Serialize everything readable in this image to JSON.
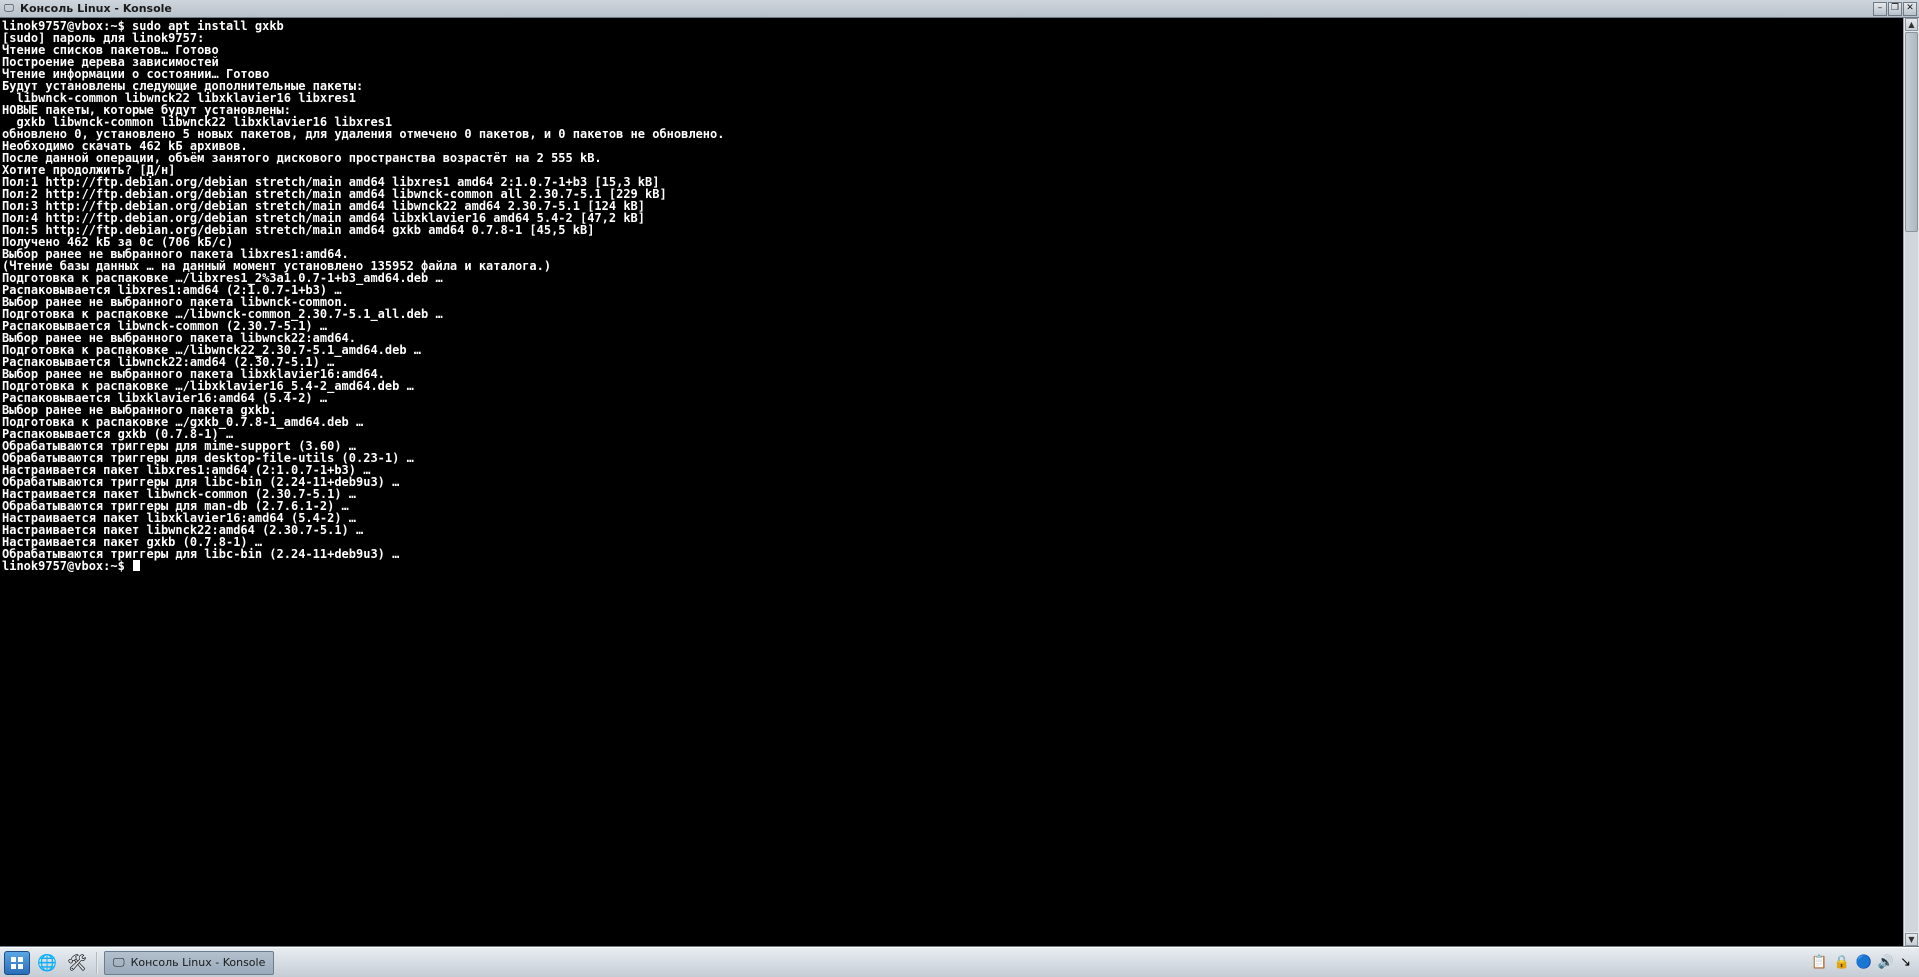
{
  "window": {
    "title": "Консоль Linux - Konsole"
  },
  "terminal": {
    "prompt1": "linok9757@vbox:~$ ",
    "command1": "sudo apt install gxkb",
    "lines": [
      "[sudo] пароль для linok9757:",
      "Чтение списков пакетов… Готово",
      "Построение дерева зависимостей",
      "Чтение информации о состоянии… Готово",
      "Будут установлены следующие дополнительные пакеты:",
      "  libwnck-common libwnck22 libxklavier16 libxres1",
      "НОВЫЕ пакеты, которые будут установлены:",
      "  gxkb libwnck-common libwnck22 libxklavier16 libxres1",
      "обновлено 0, установлено 5 новых пакетов, для удаления отмечено 0 пакетов, и 0 пакетов не обновлено.",
      "Необходимо скачать 462 kБ архивов.",
      "После данной операции, объём занятого дискового пространства возрастёт на 2 555 kB.",
      "Хотите продолжить? [Д/н]",
      "Пол:1 http://ftp.debian.org/debian stretch/main amd64 libxres1 amd64 2:1.0.7-1+b3 [15,3 kB]",
      "Пол:2 http://ftp.debian.org/debian stretch/main amd64 libwnck-common all 2.30.7-5.1 [229 kB]",
      "Пол:3 http://ftp.debian.org/debian stretch/main amd64 libwnck22 amd64 2.30.7-5.1 [124 kB]",
      "Пол:4 http://ftp.debian.org/debian stretch/main amd64 libxklavier16 amd64 5.4-2 [47,2 kB]",
      "Пол:5 http://ftp.debian.org/debian stretch/main amd64 gxkb amd64 0.7.8-1 [45,5 kB]",
      "Получено 462 kБ за 0с (706 kБ/c)",
      "Выбор ранее не выбранного пакета libxres1:amd64.",
      "(Чтение базы данных … на данный момент установлено 135952 файла и каталога.)",
      "Подготовка к распаковке …/libxres1_2%3a1.0.7-1+b3_amd64.deb …",
      "Распаковывается libxres1:amd64 (2:1.0.7-1+b3) …",
      "Выбор ранее не выбранного пакета libwnck-common.",
      "Подготовка к распаковке …/libwnck-common_2.30.7-5.1_all.deb …",
      "Распаковывается libwnck-common (2.30.7-5.1) …",
      "Выбор ранее не выбранного пакета libwnck22:amd64.",
      "Подготовка к распаковке …/libwnck22_2.30.7-5.1_amd64.deb …",
      "Распаковывается libwnck22:amd64 (2.30.7-5.1) …",
      "Выбор ранее не выбранного пакета libxklavier16:amd64.",
      "Подготовка к распаковке …/libxklavier16_5.4-2_amd64.deb …",
      "Распаковывается libxklavier16:amd64 (5.4-2) …",
      "Выбор ранее не выбранного пакета gxkb.",
      "Подготовка к распаковке …/gxkb_0.7.8-1_amd64.deb …",
      "Распаковывается gxkb (0.7.8-1) …",
      "Обрабатываются триггеры для mime-support (3.60) …",
      "Обрабатываются триггеры для desktop-file-utils (0.23-1) …",
      "Настраивается пакет libxres1:amd64 (2:1.0.7-1+b3) …",
      "Обрабатываются триггеры для libc-bin (2.24-11+deb9u3) …",
      "Настраивается пакет libwnck-common (2.30.7-5.1) …",
      "Обрабатываются триггеры для man-db (2.7.6.1-2) …",
      "Настраивается пакет libxklavier16:amd64 (5.4-2) …",
      "Настраивается пакет libwnck22:amd64 (2.30.7-5.1) …",
      "Настраивается пакет gxkb (0.7.8-1) …",
      "Обрабатываются триггеры для libc-bin (2.24-11+deb9u3) …"
    ],
    "prompt2": "linok9757@vbox:~$ "
  },
  "taskbar": {
    "task_label": "Консоль Linux - Konsole"
  },
  "icons": {
    "app": "🖵",
    "minimize": "–",
    "maximize": "❐",
    "close": "✕",
    "menu": "⋮⋮",
    "globe": "🌐",
    "tools": "🛠",
    "terminal": "🖵",
    "arrow_up": "▲",
    "arrow_down": "▼",
    "tray_note": "📋",
    "tray_disk": "🔒",
    "tray_net": "🔵",
    "tray_vol": "🔊",
    "tray_arrow": "↘"
  }
}
